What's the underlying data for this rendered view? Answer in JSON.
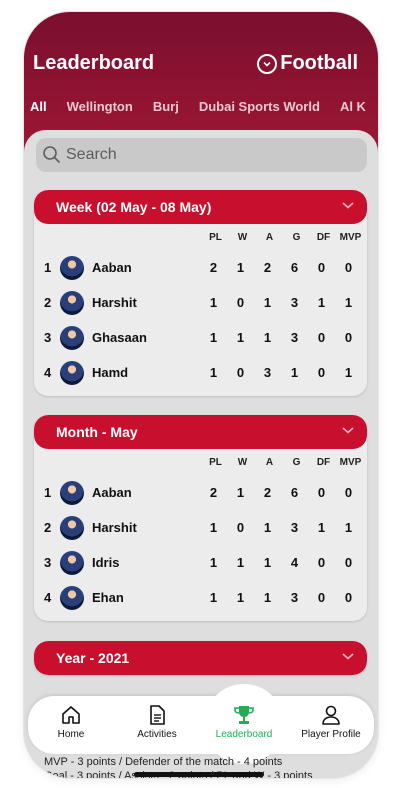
{
  "header": {
    "title": "Leaderboard",
    "sport": "Football"
  },
  "tabs": [
    "All",
    "Wellington",
    "Burj",
    "Dubai Sports World",
    "Al K"
  ],
  "search": {
    "placeholder": "Search"
  },
  "columns": [
    "PL",
    "W",
    "A",
    "G",
    "DF",
    "MVP"
  ],
  "sections": [
    {
      "title": "Week (02 May - 08 May)",
      "rows": [
        {
          "rank": "1",
          "name": "Aaban",
          "stats": [
            "2",
            "1",
            "2",
            "6",
            "0",
            "0"
          ]
        },
        {
          "rank": "2",
          "name": "Harshit",
          "stats": [
            "1",
            "0",
            "1",
            "3",
            "1",
            "1"
          ]
        },
        {
          "rank": "3",
          "name": "Ghasaan",
          "stats": [
            "1",
            "1",
            "1",
            "3",
            "0",
            "0"
          ]
        },
        {
          "rank": "4",
          "name": "Hamd",
          "stats": [
            "1",
            "0",
            "3",
            "1",
            "0",
            "1"
          ]
        }
      ]
    },
    {
      "title": "Month - May",
      "rows": [
        {
          "rank": "1",
          "name": "Aaban",
          "stats": [
            "2",
            "1",
            "2",
            "6",
            "0",
            "0"
          ]
        },
        {
          "rank": "2",
          "name": "Harshit",
          "stats": [
            "1",
            "0",
            "1",
            "3",
            "1",
            "1"
          ]
        },
        {
          "rank": "3",
          "name": "Idris",
          "stats": [
            "1",
            "1",
            "1",
            "4",
            "0",
            "0"
          ]
        },
        {
          "rank": "4",
          "name": "Ehan",
          "stats": [
            "1",
            "1",
            "1",
            "3",
            "0",
            "0"
          ]
        }
      ]
    },
    {
      "title": "Year - 2021"
    }
  ],
  "footer": {
    "line1": "MVP - 3 points / Defender of the match - 4 points",
    "line2": "Goal - 3 points / Assists - 2 points / PL and W - 3 points"
  },
  "nav": {
    "items": [
      {
        "label": "Home",
        "icon": "home-icon"
      },
      {
        "label": "Activities",
        "icon": "document-icon"
      },
      {
        "label": "Leaderboard",
        "icon": "trophy-icon"
      },
      {
        "label": "Player Profile",
        "icon": "user-icon"
      }
    ]
  },
  "colors": {
    "brand": "#c8102e",
    "header": "#9a1633",
    "active": "#1fae55"
  }
}
